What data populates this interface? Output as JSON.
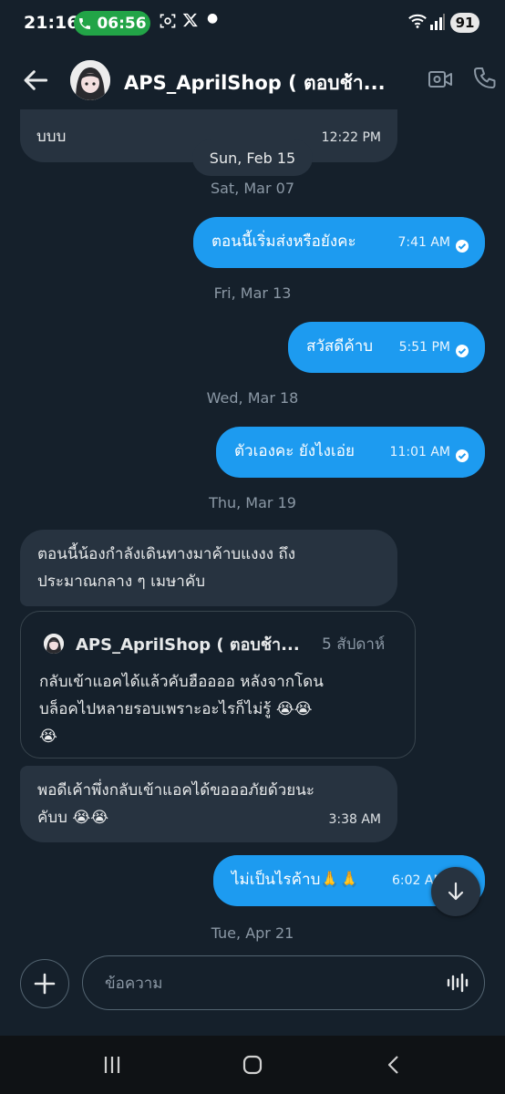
{
  "status_bar": {
    "time": "21:16",
    "call_timer": "06:56",
    "battery": "91"
  },
  "header": {
    "title": "APS_AprilShop ( ตอบช้า..."
  },
  "sticky_date": "Sun, Feb 15",
  "messages": [
    {
      "type": "received",
      "text": "บบบ",
      "time": "12:22 PM"
    },
    {
      "type": "date",
      "text": "Sat, Mar 07"
    },
    {
      "type": "sent",
      "text": "ตอนนี้เริ่มส่งหรือยังคะ",
      "time": "7:41 AM"
    },
    {
      "type": "date",
      "text": "Fri, Mar 13"
    },
    {
      "type": "sent",
      "text": "สวัสดีค้าบ",
      "time": "5:51 PM"
    },
    {
      "type": "date",
      "text": "Wed, Mar 18"
    },
    {
      "type": "sent",
      "text": "ตัวเองคะ ยังไงเอ่ย",
      "time": "11:01 AM"
    },
    {
      "type": "date",
      "text": "Thu, Mar 19"
    },
    {
      "type": "received",
      "line1": "ตอนนี้น้องกำลังเดินทางมาค้าบแงงง ถึง",
      "line2": "ประมาณกลาง ๆ เมษาคับ"
    },
    {
      "type": "received",
      "line1": "พอดีเค้าพึ่งกลับเข้าแอคได้ขอออภัยด้วยนะ",
      "line2": "คับบ 😭😭",
      "time": "3:38 AM"
    },
    {
      "type": "sent",
      "text": "ไม่เป็นไรค้าบ🙏🙏",
      "time": "6:02 AM"
    },
    {
      "type": "date",
      "text": "Tue, Apr 21"
    }
  ],
  "quoted_post": {
    "author": "APS_AprilShop ( ตอบช้า...",
    "time": "5 สัปดาห์",
    "line1": "กลับเข้าแอคได้แล้วคับฮืออออ หลังจากโดน",
    "line2": "บล็อคไปหลายรอบเพราะอะไรก็ไม่รู้ 😭😭",
    "line3": "😭"
  },
  "composer": {
    "placeholder": "ข้อความ"
  },
  "icons": {
    "back": "arrow-left",
    "video": "video-camera",
    "call": "phone",
    "scroll": "arrow-down",
    "add": "plus",
    "voice": "voice-wave",
    "sent_status": "check-circle"
  },
  "colors": {
    "background": "#15202b",
    "sent_bubble": "#1d9bf0",
    "received_bubble": "#273340",
    "call_pill": "#22a447"
  }
}
